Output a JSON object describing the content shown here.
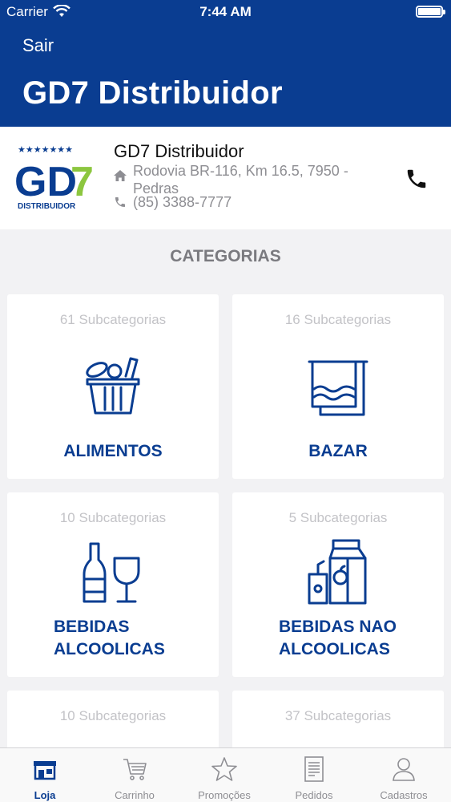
{
  "status_bar": {
    "carrier": "Carrier",
    "time": "7:44 AM"
  },
  "nav": {
    "back_label": "Sair",
    "title": "GD7 Distribuidor"
  },
  "store": {
    "name": "GD7 Distribuidor",
    "address": "Rodovia BR-116, Km 16.5, 7950 - Pedras",
    "phone": "(85) 3388-7777",
    "logo": {
      "text": "GD7",
      "subtext": "DISTRIBUIDOR"
    }
  },
  "categories_heading": "CATEGORIAS",
  "categories": [
    {
      "subcount": "61 Subcategorias",
      "title": "ALIMENTOS",
      "icon": "grocery-basket-icon"
    },
    {
      "subcount": "16 Subcategorias",
      "title": "BAZAR",
      "icon": "towel-rack-icon"
    },
    {
      "subcount": "10 Subcategorias",
      "title_line1": "BEBIDAS",
      "title_line2": "ALCOOLICAS",
      "icon": "wine-bottle-glass-icon"
    },
    {
      "subcount": "5 Subcategorias",
      "title_line1": "BEBIDAS NAO",
      "title_line2": "ALCOOLICAS",
      "icon": "juice-carton-icon"
    },
    {
      "subcount": "10 Subcategorias"
    },
    {
      "subcount": "37 Subcategorias"
    }
  ],
  "tabs": [
    {
      "label": "Loja",
      "icon": "store-icon",
      "active": true
    },
    {
      "label": "Carrinho",
      "icon": "cart-icon"
    },
    {
      "label": "Promoções",
      "icon": "star-icon"
    },
    {
      "label": "Pedidos",
      "icon": "receipt-icon"
    },
    {
      "label": "Cadastros",
      "icon": "user-icon"
    }
  ],
  "colors": {
    "brand": "#0a3d91",
    "logo_green": "#8cc63f",
    "muted": "#8e8e93"
  }
}
